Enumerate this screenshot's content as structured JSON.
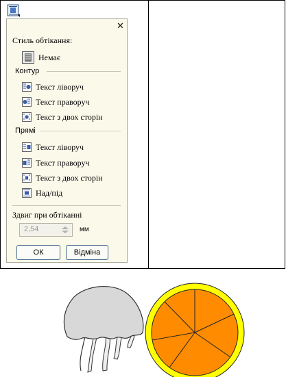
{
  "dialog": {
    "wrap_style_label": "Стиль обтікання:",
    "none_label": "Немає",
    "contour": {
      "heading": "Контур",
      "items": [
        "Текст ліворуч",
        "Текст праворуч",
        "Текст з двох сторін"
      ]
    },
    "straight": {
      "heading": "Прямі",
      "items": [
        "Текст ліворуч",
        "Текст праворуч",
        "Текст з двох сторін",
        "Над/під"
      ]
    },
    "offset_label": "Здвиг при обтіканні",
    "offset_value": "2,54",
    "offset_unit": "мм",
    "ok_label": "ОК",
    "cancel_label": "Відміна"
  },
  "colors": {
    "dialog_bg": "#fbf9ea",
    "jellyfish_fill": "#d8d8d8",
    "orange_rind": "#ffff00",
    "orange_flesh": "#ff8c00"
  }
}
